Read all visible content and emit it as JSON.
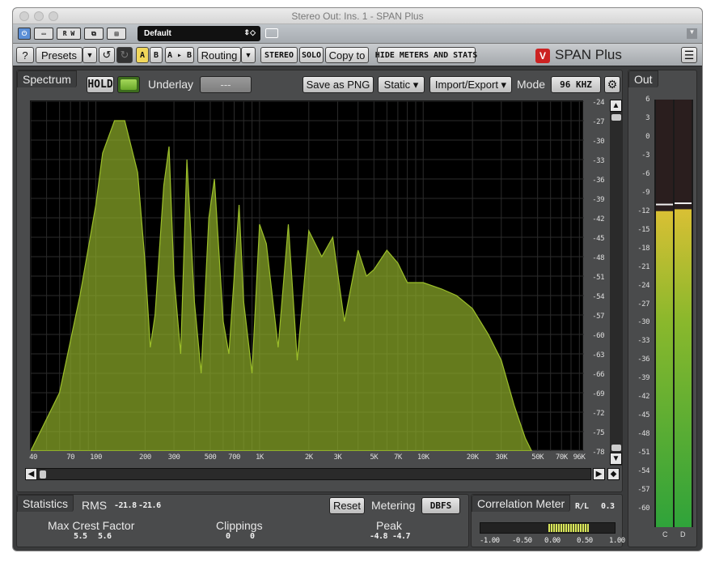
{
  "window": {
    "title": "Stereo Out: Ins. 1 - SPAN Plus"
  },
  "host": {
    "preset_name": "Default",
    "buttons": [
      "R",
      "W"
    ]
  },
  "toolbar": {
    "help": "?",
    "presets": "Presets",
    "a": "A",
    "b": "B",
    "ab": "A ▸ B",
    "routing": "Routing",
    "stereo": "STEREO",
    "solo": "SOLO",
    "copy": "Copy to",
    "hide": "HIDE METERS AND STATS",
    "logo": "SPAN Plus"
  },
  "spectrum": {
    "label": "Spectrum",
    "hold": "HOLD",
    "underlay_label": "Underlay",
    "underlay_value": "---",
    "save_png": "Save as PNG",
    "static": "Static ▾",
    "import_export": "Import/Export ▾",
    "mode_label": "Mode",
    "mode_value": "96 KHZ",
    "y_ticks": [
      "-24",
      "-27",
      "-30",
      "-33",
      "-36",
      "-39",
      "-42",
      "-45",
      "-48",
      "-51",
      "-54",
      "-57",
      "-60",
      "-63",
      "-66",
      "-69",
      "-72",
      "-75",
      "-78"
    ],
    "x_ticks": [
      {
        "f": 40,
        "label": "40"
      },
      {
        "f": 70,
        "label": "70"
      },
      {
        "f": 100,
        "label": "100"
      },
      {
        "f": 200,
        "label": "200"
      },
      {
        "f": 300,
        "label": "300"
      },
      {
        "f": 500,
        "label": "500"
      },
      {
        "f": 700,
        "label": "700"
      },
      {
        "f": 1000,
        "label": "1K"
      },
      {
        "f": 2000,
        "label": "2K"
      },
      {
        "f": 3000,
        "label": "3K"
      },
      {
        "f": 5000,
        "label": "5K"
      },
      {
        "f": 7000,
        "label": "7K"
      },
      {
        "f": 10000,
        "label": "10K"
      },
      {
        "f": 20000,
        "label": "20K"
      },
      {
        "f": 30000,
        "label": "30K"
      },
      {
        "f": 50000,
        "label": "50K"
      },
      {
        "f": 70000,
        "label": "70K"
      },
      {
        "f": 96000,
        "label": "96K"
      }
    ],
    "color": "#9cbf2a"
  },
  "chart_data": {
    "type": "area",
    "title": "",
    "xlabel": "",
    "ylabel": "",
    "x_scale": "log",
    "xlim": [
      40,
      96000
    ],
    "ylim": [
      -78,
      -24
    ],
    "series": [
      {
        "x": [
          40,
          60,
          80,
          100,
          110,
          130,
          150,
          180,
          200,
          215,
          230,
          260,
          280,
          300,
          330,
          360,
          400,
          440,
          490,
          530,
          600,
          650,
          750,
          800,
          900,
          1000,
          1100,
          1300,
          1500,
          1700,
          2000,
          2400,
          2800,
          3300,
          4000,
          4500,
          5000,
          6000,
          7000,
          8000,
          10000,
          13000,
          16000,
          20000,
          25000,
          30000,
          36000,
          42000,
          46000
        ],
        "y": [
          -78,
          -69,
          -54,
          -40,
          -32,
          -27,
          -27,
          -35,
          -49,
          -62,
          -57,
          -37,
          -31,
          -51,
          -63,
          -33,
          -55,
          -66,
          -42,
          -36,
          -58,
          -63,
          -40,
          -55,
          -66,
          -43,
          -46,
          -62,
          -43,
          -64,
          -44,
          -48,
          -45,
          -58,
          -47,
          -51,
          -50,
          -47,
          -49,
          -52,
          -52,
          -53,
          -54,
          -56,
          -60,
          -64,
          -71,
          -76,
          -78
        ]
      }
    ]
  },
  "statistics": {
    "label": "Statistics",
    "rms_label": "RMS",
    "rms_l": "-21.8",
    "rms_r": "-21.6",
    "reset": "Reset",
    "metering_label": "Metering",
    "metering_value": "DBFS",
    "crest_label": "Max Crest Factor",
    "crest_l": "5.5",
    "crest_r": "5.6",
    "clip_label": "Clippings",
    "clip_l": "0",
    "clip_r": "0",
    "peak_label": "Peak",
    "peak_l": "-4.8",
    "peak_r": "-4.7"
  },
  "correlation": {
    "label": "Correlation Meter",
    "mode": "R/L",
    "value": "0.3",
    "ticks": [
      "-1.00",
      "-0.50",
      "0.00",
      "0.50",
      "1.00"
    ]
  },
  "out_meter": {
    "label": "Out",
    "ticks": [
      "6",
      "3",
      "0",
      "-3",
      "-6",
      "-9",
      "-12",
      "-15",
      "-18",
      "-21",
      "-24",
      "-27",
      "-30",
      "-33",
      "-36",
      "-39",
      "-42",
      "-45",
      "-48",
      "-51",
      "-54",
      "-57",
      "-60"
    ],
    "channels": [
      "C",
      "D"
    ],
    "level_l": -12.0,
    "level_r": -11.7,
    "hold_l": -10.8,
    "hold_r": -10.6
  }
}
